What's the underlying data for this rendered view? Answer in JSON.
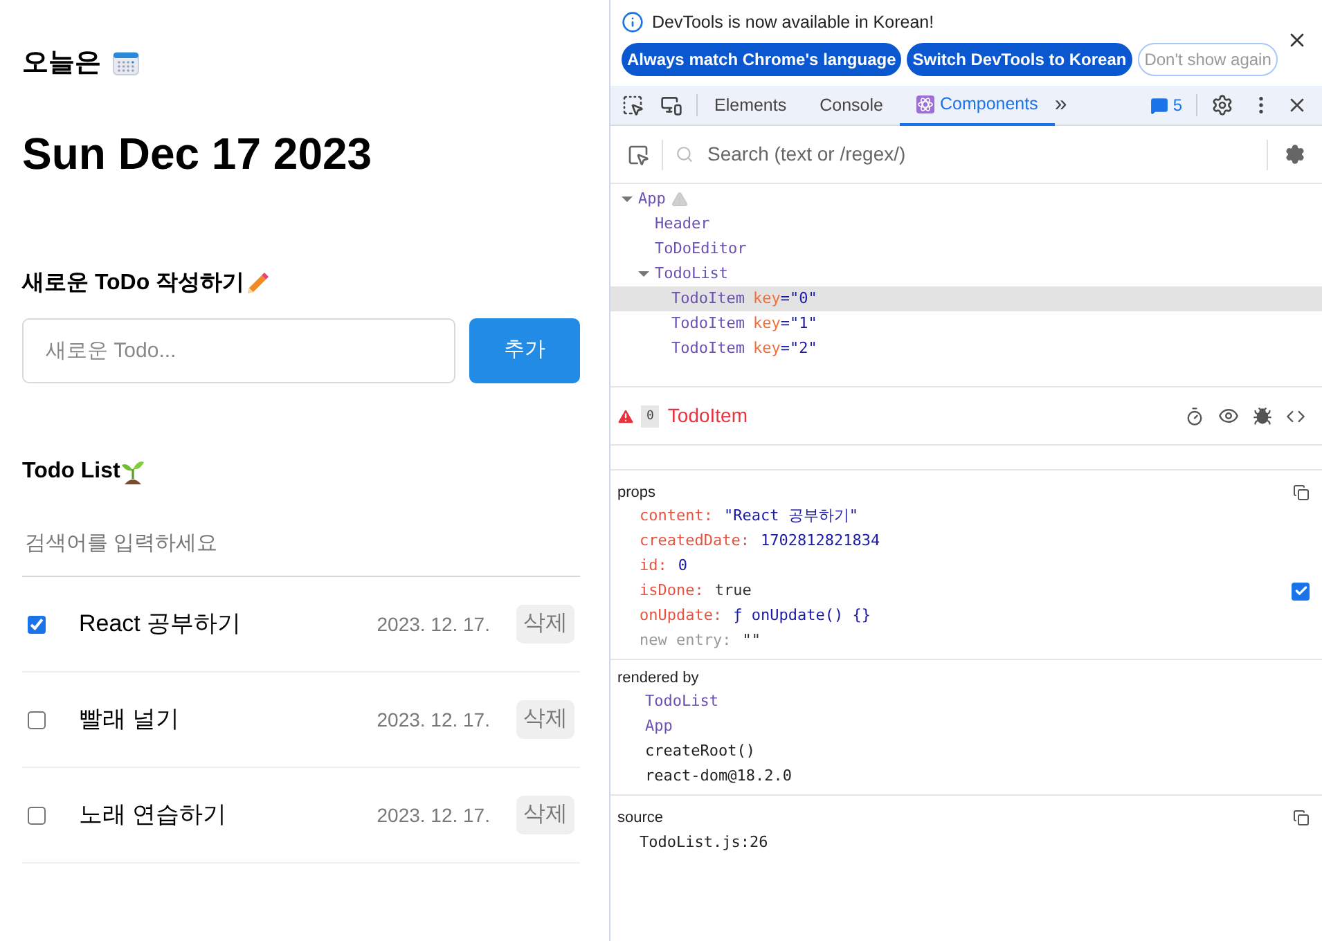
{
  "app": {
    "today_label": "오늘은",
    "date": "Sun Dec 17 2023",
    "editor_title": "새로운 ToDo 작성하기",
    "new_todo": {
      "placeholder": "새로운 Todo..."
    },
    "add_button": "추가",
    "list_title": "Todo List",
    "search": {
      "placeholder": "검색어를 입력하세요"
    },
    "todos": [
      {
        "content": "React 공부하기",
        "checked": true,
        "date": "2023. 12. 17.",
        "delete": "삭제"
      },
      {
        "content": "빨래 널기",
        "checked": false,
        "date": "2023. 12. 17.",
        "delete": "삭제"
      },
      {
        "content": "노래 연습하기",
        "checked": false,
        "date": "2023. 12. 17.",
        "delete": "삭제"
      }
    ]
  },
  "devtools": {
    "infobar": {
      "message": "DevTools is now available in Korean!",
      "buttons": [
        {
          "label": "Always match Chrome's language",
          "kind": "primary"
        },
        {
          "label": "Switch DevTools to Korean",
          "kind": "primary"
        },
        {
          "label": "Don't show again",
          "kind": "secondary"
        }
      ]
    },
    "tabs": [
      {
        "label": "Elements",
        "selected": false
      },
      {
        "label": "Console",
        "selected": false
      },
      {
        "label": "Components",
        "selected": true
      }
    ],
    "more_tabs": "»",
    "issues_count": "5",
    "search": {
      "placeholder": "Search (text or /regex/)"
    },
    "tree": [
      {
        "name": "App",
        "warning": true,
        "expanded": true,
        "selected": false,
        "children": [
          {
            "name": "Header",
            "selected": false
          },
          {
            "name": "ToDoEditor",
            "selected": false
          },
          {
            "name": "TodoList",
            "expanded": true,
            "selected": false,
            "children": [
              {
                "name": "TodoItem",
                "key_label": "key",
                "key_value": "=\"0\"",
                "selected": true
              },
              {
                "name": "TodoItem",
                "key_label": "key",
                "key_value": "=\"1\"",
                "selected": false
              },
              {
                "name": "TodoItem",
                "key_label": "key",
                "key_value": "=\"2\"",
                "selected": false
              }
            ]
          }
        ]
      }
    ],
    "selected": {
      "badge": "0",
      "name": "TodoItem"
    },
    "props": {
      "title": "props",
      "items": [
        {
          "key": "content:",
          "value": "\"React 공부하기\"",
          "kind": "string"
        },
        {
          "key": "createdDate:",
          "value": "1702812821834",
          "kind": "number"
        },
        {
          "key": "id:",
          "value": "0",
          "kind": "number"
        },
        {
          "key": "isDone:",
          "value": "true",
          "kind": "boolean",
          "checked": true
        },
        {
          "key": "onUpdate:",
          "value": "ƒ onUpdate() {}",
          "kind": "function"
        },
        {
          "key": "new entry:",
          "value": "\"\"",
          "kind": "new"
        }
      ]
    },
    "rendered_by": {
      "title": "rendered by",
      "items": [
        {
          "label": "TodoList",
          "kind": "component"
        },
        {
          "label": "App",
          "kind": "component"
        },
        {
          "label": "createRoot()",
          "kind": "plain"
        },
        {
          "label": "react-dom@18.2.0",
          "kind": "plain"
        }
      ]
    },
    "source": {
      "title": "source",
      "file": "TodoList.js:26"
    }
  }
}
